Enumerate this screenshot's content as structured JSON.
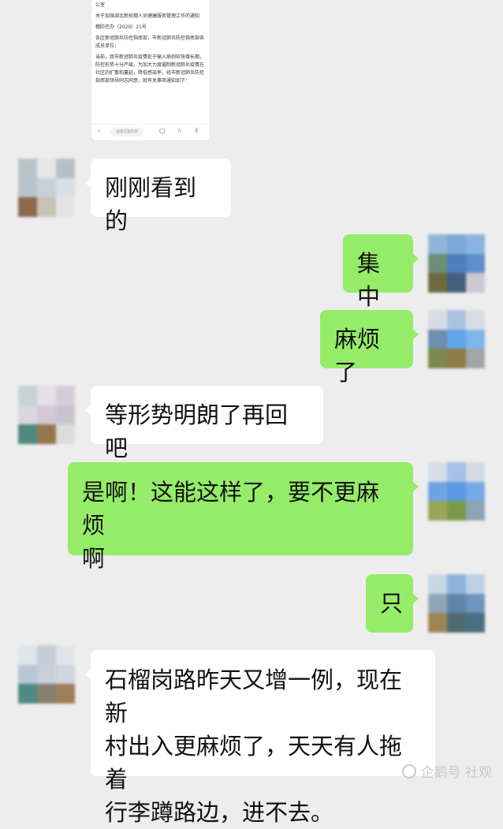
{
  "shared_document": {
    "lines": [
      "公室",
      "关于加强湖北新抵穗人员健康服务管理工作的通知",
      "穗防控办（2020）21号",
      "各区新冠肺炎防控指挥部，市新冠肺炎防控指挥部各成员单位：",
      "当前，我市新冠肺炎疫情处于输入病例较快增长期，防控形势十分严峻。为加大力度遏制新冠肺炎疫情在社区的扩散和蔓延，降低感染率，经市新冠肺炎防控指挥部领导同志同意，就有关事项通知如下："
    ],
    "toolbar": {
      "back_icon": "chevron-left-icon",
      "search_placeholder": "搜索这篇内容",
      "comment_icon": "comment-icon",
      "star_icon": "star-icon",
      "share_icon": "share-icon"
    }
  },
  "messages": [
    {
      "side": "left",
      "text": "刚刚看到的"
    },
    {
      "side": "right",
      "text": "集中"
    },
    {
      "side": "right",
      "text": "麻烦了"
    },
    {
      "side": "left",
      "text": "等形势明朗了再回吧"
    },
    {
      "side": "right",
      "line1": "是啊！这能这样了，要不更麻烦",
      "line2": "啊"
    },
    {
      "side": "right",
      "text": "只"
    },
    {
      "side": "left",
      "line1": "石榴岗路昨天又增一例，现在新",
      "line2": "村出入更麻烦了，天天有人拖着",
      "line3": "行李蹲路边，进不去。"
    }
  ],
  "watermark": {
    "text": "企鹅号 社观",
    "icon": "penguin-icon"
  },
  "colors": {
    "background": "#ededed",
    "left_bubble": "#ffffff",
    "right_bubble": "#95ec69"
  }
}
